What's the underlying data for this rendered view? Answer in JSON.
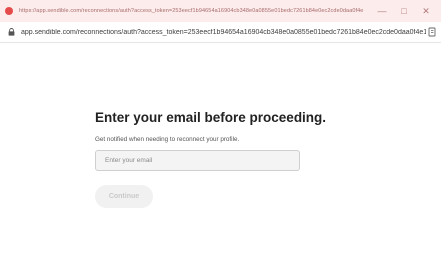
{
  "window": {
    "title_url": "https://app.sendible.com/reconnections/auth?access_token=253eecf1b94654a16904cb348e0a0855e01bedc7261b84e0ec2cde0daa0f4e...",
    "controls": {
      "minimize": "—",
      "maximize": "□",
      "close": "✕"
    }
  },
  "address_bar": {
    "url": "app.sendible.com/reconnections/auth?access_token=253eecf1b94654a16904cb348e0a0855e01bedc7261b84e0ec2cde0daa0f4e1..."
  },
  "form": {
    "heading": "Enter your email before proceeding.",
    "subtext": "Get notified when needing to reconnect your profile.",
    "email_placeholder": "Enter your email",
    "continue_label": "Continue"
  },
  "colors": {
    "titlebar_bg": "#fcecec",
    "favicon": "#e64b4b",
    "button_disabled_bg": "#f1f1f1"
  },
  "icons": {
    "favicon": "sendible-favicon-icon",
    "lock": "lock-icon",
    "address_action": "bookmark-icon"
  }
}
